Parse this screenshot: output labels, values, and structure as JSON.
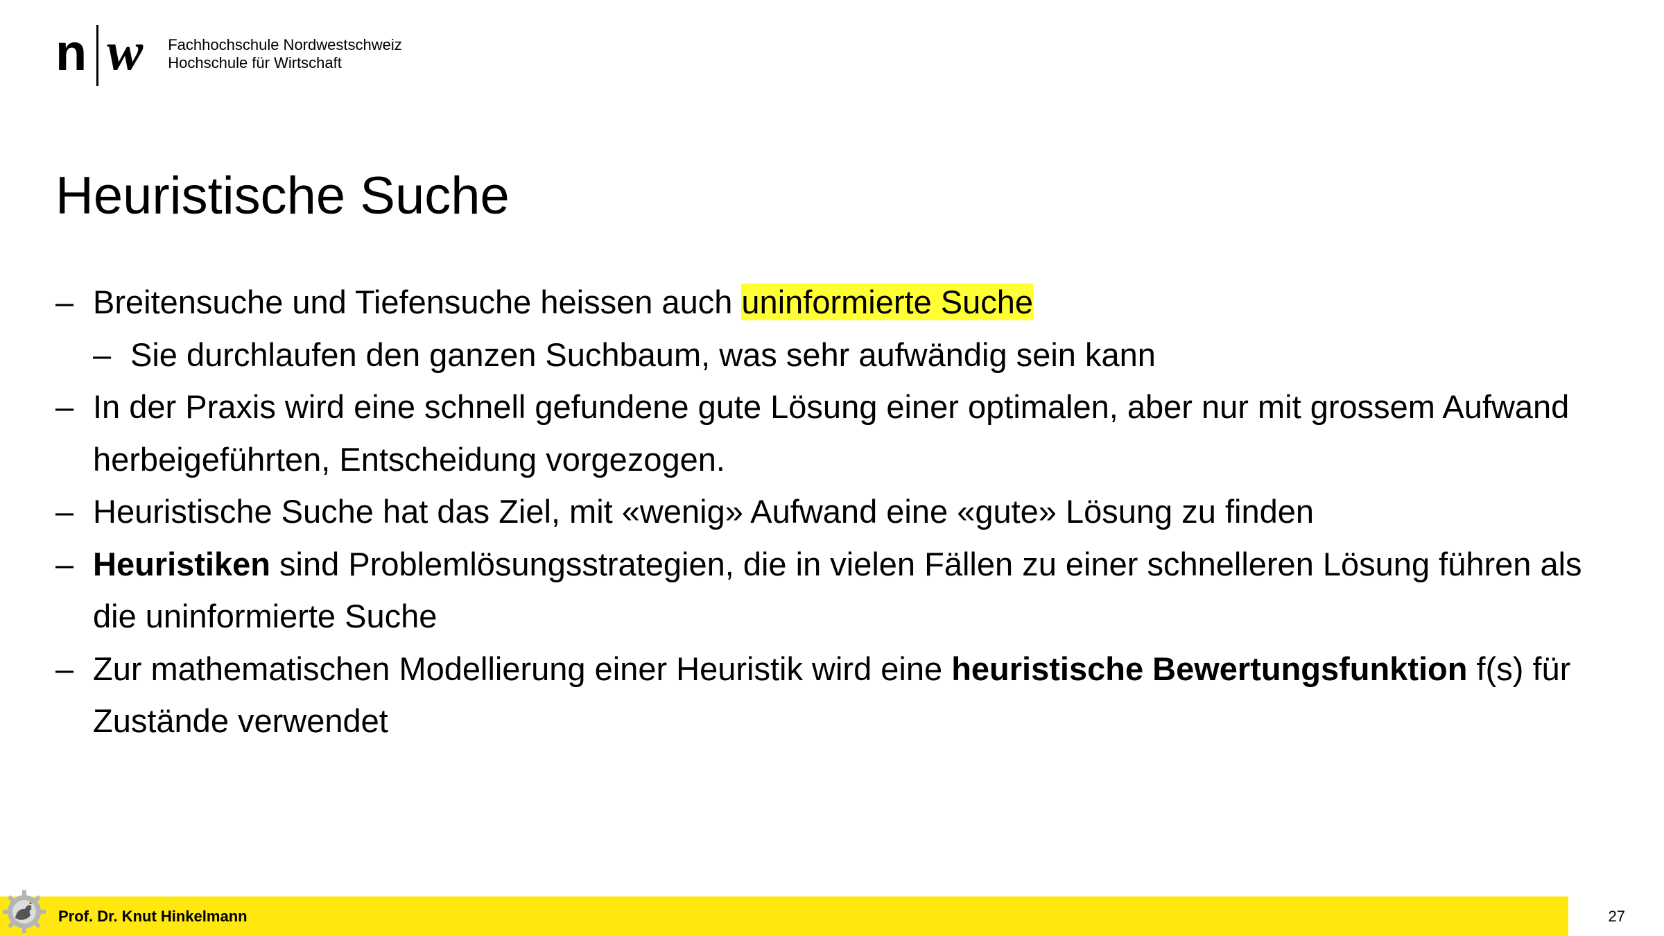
{
  "header": {
    "logo_n": "n",
    "logo_w": "w",
    "institution_line1": "Fachhochschule Nordwestschweiz",
    "institution_line2": "Hochschule für Wirtschaft"
  },
  "slide": {
    "title": "Heuristische Suche",
    "bullets": [
      {
        "level": 1,
        "dash": "–",
        "text_before": "Breitensuche und Tiefensuche heissen auch ",
        "highlight": "uninformierte Suche"
      },
      {
        "level": 2,
        "dash": "–",
        "text": "Sie durchlaufen den ganzen Suchbaum, was sehr aufwändig sein kann"
      },
      {
        "level": 1,
        "dash": "–",
        "text": "In der Praxis wird eine schnell gefundene gute Lösung einer optimalen, aber nur mit grossem Aufwand herbeigeführten, Entscheidung vorgezogen."
      },
      {
        "level": 1,
        "dash": "–",
        "text": "Heuristische Suche hat das Ziel, mit «wenig» Aufwand eine «gute» Lösung zu finden"
      },
      {
        "level": 1,
        "dash": "–",
        "bold": "Heuristiken",
        "text_after": " sind Problemlösungsstrategien, die in vielen Fällen zu einer schnelleren Lösung führen als die uninformierte Suche"
      },
      {
        "level": 1,
        "dash": "–",
        "text_before": "Zur mathematischen Modellierung einer Heuristik wird eine ",
        "bold": "heuristische Bewertungsfunktion",
        "text_after": " f(s) für Zustände verwendet"
      }
    ]
  },
  "footer": {
    "author": "Prof. Dr. Knut Hinkelmann",
    "page_number": "27",
    "icon": "rooster-gear-icon"
  },
  "colors": {
    "footer_bar": "#ffe80f",
    "highlight": "#ffff33",
    "text": "#000000"
  }
}
